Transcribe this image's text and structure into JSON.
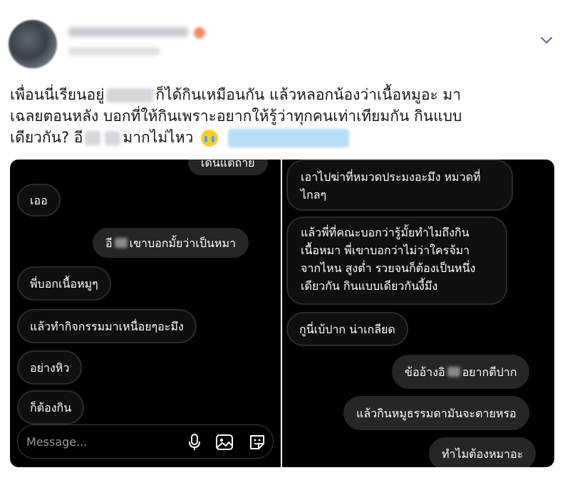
{
  "tweet": {
    "text_lines": [
      [
        "เพื่อนนี่เรียนอยู่",
        "ก็ได้กินเหมือนกัน แล้วหลอกน้องว่าเนื้อหมูอะ มา"
      ],
      [
        "เฉลยตอนหลัง บอกที่ให้กินเพราะอยากให้รู้ว่าทุกคนเท่าเทียมกัน กินแบบ"
      ],
      [
        "เดียวกัน? อี",
        "",
        "มากไม่ไหว"
      ]
    ]
  },
  "left_chat": {
    "bubbles": [
      {
        "text": "เดินแต่ถ้าย"
      },
      {
        "text": "เออ"
      },
      {
        "text_before": "อี",
        "text_after": "เขาบอกมั้ยว่าเป็นหมา"
      },
      {
        "text": "พี่บอกเนื้อหมูๆ"
      },
      {
        "text": "แล้วทำกิจกรรมมาเหนื่อยๆอะมึง"
      },
      {
        "text": "อย่างหิว"
      },
      {
        "text": "ก็ต้องกิน"
      }
    ],
    "composer": {
      "placeholder": "Message..."
    },
    "icons": [
      "microphone-icon",
      "image-icon",
      "sticker-icon"
    ]
  },
  "right_chat": {
    "bubbles": [
      {
        "lines": [
          "เอาไปฆ่าที่หมวดประมงอะมึง หมวดที่",
          "ไกลๆ"
        ]
      },
      {
        "lines": [
          "แล้วพี่ที่คณะบอกว่ารู้มั้ยทำไมถึงกิน",
          "เนื้อหมา พี่เขาบอกว่าไม่ว่าใครจ้มา",
          "จากไหน สูงต่ำ รวยจนก็ต้องเป็นหนึ่ง",
          "เดียวกัน กินแบบเดียวกันงี้มึง"
        ]
      },
      {
        "text": "กูนี่เบ้ปาก น่าเกลียด"
      },
      {
        "text_before": "ข้ออ้างอิ",
        "text_after": "อยากตีปาก"
      },
      {
        "text": "แล้วกินหมูธรรมดามันจะตายหรอ"
      },
      {
        "text": "ทำไมต้องหมาอะ"
      }
    ]
  },
  "colors": {
    "dm_background": "#000000",
    "sent_bubble": "#262626",
    "received_border": "#2a2a2a",
    "text_primary": "#14171a"
  }
}
